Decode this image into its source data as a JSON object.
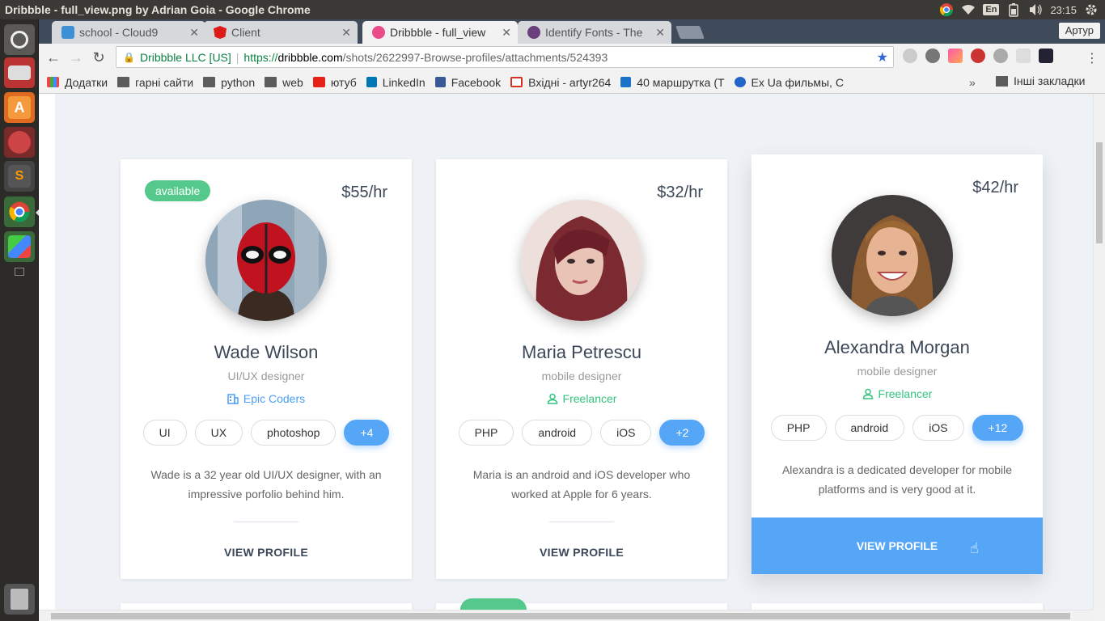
{
  "system": {
    "window_title": "Dribbble - full_view.png by Adrian Goia - Google Chrome",
    "lang": "En",
    "clock": "23:15"
  },
  "browser": {
    "tabs": [
      {
        "label": "school - Cloud9",
        "color": "#3d8fd6"
      },
      {
        "label": "Client",
        "color": "#dd1b16"
      },
      {
        "label": "Dribbble - full_view",
        "color": "#ea4c89"
      },
      {
        "label": "Identify Fonts - The",
        "color": "#6a3f7a"
      }
    ],
    "profile_name": "Артур",
    "omnibox": {
      "secure_label": "Dribbble LLC [US]",
      "protocol": "https://",
      "host": "dribbble.com",
      "path": "/shots/2622997-Browse-profiles/attachments/524393"
    },
    "bookmarks": [
      {
        "label": "Додатки",
        "icon": "apps-grid-icon"
      },
      {
        "label": "гарні сайти",
        "icon": "folder-icon"
      },
      {
        "label": "python",
        "icon": "folder-icon"
      },
      {
        "label": "web",
        "icon": "folder-icon"
      },
      {
        "label": "ютуб",
        "icon": "youtube-icon"
      },
      {
        "label": "LinkedIn",
        "icon": "linkedin-icon"
      },
      {
        "label": "Facebook",
        "icon": "facebook-icon"
      },
      {
        "label": "Вхідні - artyr264",
        "icon": "gmail-icon"
      },
      {
        "label": "40 маршрутка (Т",
        "icon": "e-icon"
      },
      {
        "label": "Ex Ua фильмы, С",
        "icon": "exua-icon"
      }
    ],
    "bookmarks_more": "»",
    "other_bookmarks": "Інші закладки"
  },
  "profiles": [
    {
      "badge": "available",
      "price": "$55/hr",
      "name": "Wade Wilson",
      "role": "UI/UX designer",
      "org": "Epic Coders",
      "org_icon": "building-icon",
      "org_color": "#4a9ff5",
      "tags": [
        "UI",
        "UX",
        "photoshop",
        "+4"
      ],
      "description": "Wade is a 32 year old UI/UX designer, with an impressive porfolio behind him.",
      "cta": "VIEW PROFILE"
    },
    {
      "price": "$32/hr",
      "name": "Maria Petrescu",
      "role": "mobile designer",
      "org": "Freelancer",
      "org_icon": "user-icon",
      "org_color": "#34c37f",
      "tags": [
        "PHP",
        "android",
        "iOS",
        "+2"
      ],
      "description": "Maria is an android and iOS developer who worked at Apple for 6 years.",
      "cta": "VIEW PROFILE"
    },
    {
      "price": "$42/hr",
      "name": "Alexandra Morgan",
      "role": "mobile designer",
      "org": "Freelancer",
      "org_icon": "user-icon",
      "org_color": "#34c37f",
      "tags": [
        "PHP",
        "android",
        "iOS",
        "+12"
      ],
      "description": "Alexandra is a dedicated developer for mobile platforms and is very good at it.",
      "cta": "VIEW PROFILE"
    }
  ]
}
